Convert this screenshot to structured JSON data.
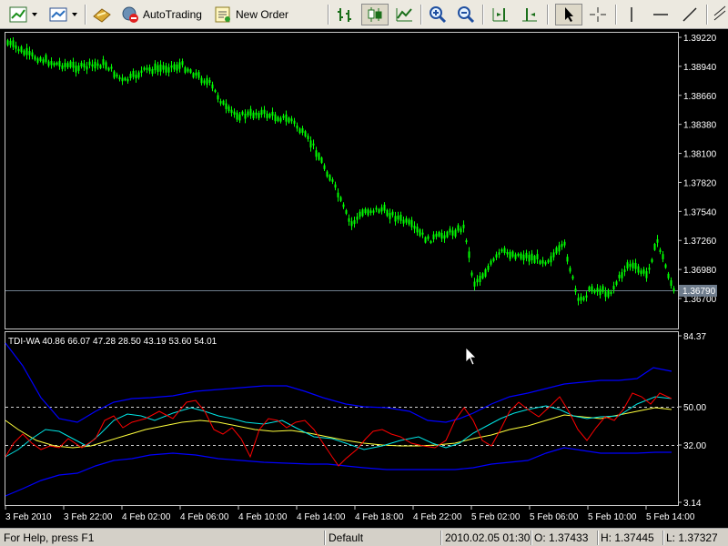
{
  "toolbar": {
    "autotrading_label": "AutoTrading",
    "new_order_label": "New Order"
  },
  "colors": {
    "candle": "#00ff00",
    "red_line": "#ff0000",
    "cyan_line": "#00e5e5",
    "yellow_line": "#ffff3c",
    "band_line": "#0000ff",
    "price_line": "#6e7c8c"
  },
  "main_chart": {
    "price_labels": [
      "1.39220",
      "1.38940",
      "1.38660",
      "1.38380",
      "1.38100",
      "1.37820",
      "1.37540",
      "1.37260",
      "1.36980",
      "1.36700"
    ],
    "current_price": "1.36790"
  },
  "indicator": {
    "title": "TDI-WA 40.86 66.07 47.28 28.50 43.19 53.60 54.01",
    "scale_labels": [
      "84.37",
      "50.00",
      "32.00",
      "3.14"
    ]
  },
  "time_axis": [
    "3 Feb 2010",
    "3 Feb 22:00",
    "4 Feb 02:00",
    "4 Feb 06:00",
    "4 Feb 10:00",
    "4 Feb 14:00",
    "4 Feb 18:00",
    "4 Feb 22:00",
    "5 Feb 02:00",
    "5 Feb 06:00",
    "5 Feb 10:00",
    "5 Feb 14:00"
  ],
  "status": {
    "help": "For Help, press F1",
    "profile": "Default",
    "datetime": "2010.02.05 01:30",
    "open": "O: 1.37433",
    "high": "H: 1.37445",
    "low": "L: 1.37327"
  }
}
